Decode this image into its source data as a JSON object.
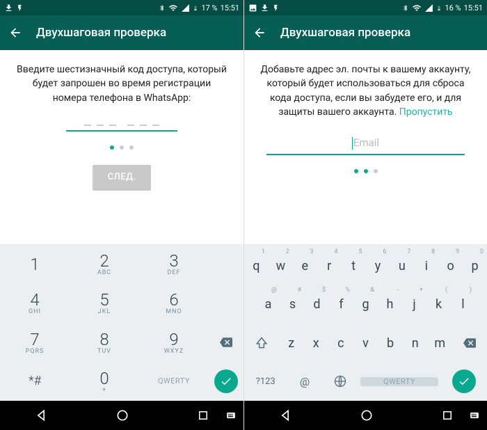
{
  "left": {
    "status": {
      "battery": "17 %",
      "time": "15:51"
    },
    "appbar": {
      "title": "Двухшаговая проверка"
    },
    "body": "Введите шестизначный код доступа, который будет запрошен во время регистрации номера телефона в WhatsApp:",
    "next_label": "СЛЕД.",
    "step_active": 0,
    "keypad": {
      "rows": [
        [
          {
            "n": "1",
            "l": ""
          },
          {
            "n": "2",
            "l": "ABC"
          },
          {
            "n": "3",
            "l": "DEF"
          }
        ],
        [
          {
            "n": "4",
            "l": "GHI"
          },
          {
            "n": "5",
            "l": "JKL"
          },
          {
            "n": "6",
            "l": "MNO"
          }
        ],
        [
          {
            "n": "7",
            "l": "PQRS"
          },
          {
            "n": "8",
            "l": "TUV"
          },
          {
            "n": "9",
            "l": "WXYZ"
          }
        ]
      ],
      "star": "*#",
      "zero": "0",
      "plus": "+",
      "mode": "QWERTY"
    }
  },
  "right": {
    "status": {
      "battery": "16 %",
      "time": "15:51"
    },
    "appbar": {
      "title": "Двухшаговая проверка"
    },
    "body": "Добавьте адрес эл. почты к вашему аккаунту, который будет использоваться для сброса кода доступа, если вы забудете его, и для защиты вашего аккаунта. ",
    "skip": "Пропустить",
    "email_placeholder": "Email",
    "step_active": 1,
    "keyboard": {
      "row1": [
        "q",
        "w",
        "e",
        "r",
        "t",
        "y",
        "u",
        "i",
        "o",
        "p"
      ],
      "row1_hints": [
        "1",
        "2",
        "3",
        "4",
        "5",
        "6",
        "7",
        "8",
        "9",
        "0"
      ],
      "row2": [
        "a",
        "s",
        "d",
        "f",
        "g",
        "h",
        "j",
        "k",
        "l"
      ],
      "row2_hints": [
        "@",
        "#",
        "$",
        "%",
        "&",
        "-",
        "+",
        "(",
        ")"
      ],
      "row3": [
        "z",
        "x",
        "c",
        "v",
        "b",
        "n",
        "m"
      ],
      "sym": "?123",
      "at": "@",
      "space": "QWERTY"
    }
  }
}
